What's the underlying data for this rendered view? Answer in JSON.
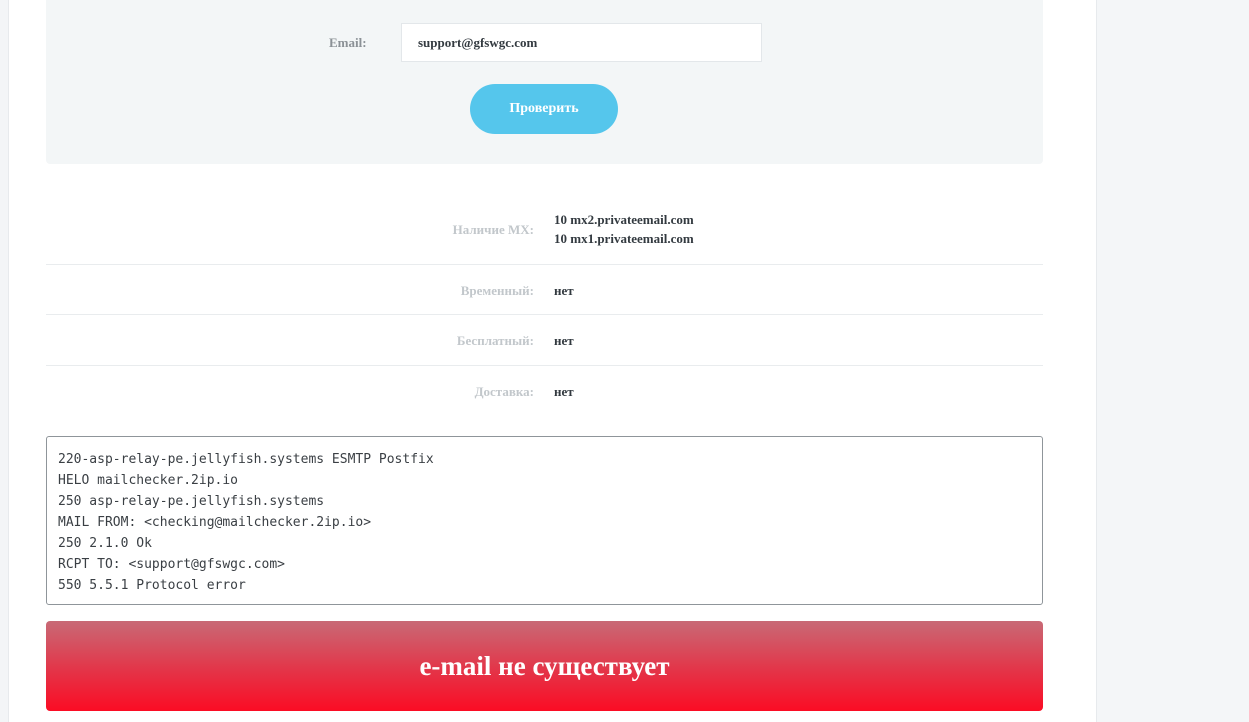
{
  "form": {
    "email_label": "Email:",
    "email_value": "support@gfswgc.com",
    "check_button": "Проверить"
  },
  "results": {
    "mx": {
      "label": "Наличие MX:",
      "values": [
        "10 mx2.privateemail.com",
        "10 mx1.privateemail.com"
      ]
    },
    "temporary": {
      "label": "Временный:",
      "value": "нет"
    },
    "free": {
      "label": "Бесплатный:",
      "value": "нет"
    },
    "delivery": {
      "label": "Доставка:",
      "value": "нет"
    }
  },
  "smtp_log": [
    "220-asp-relay-pe.jellyfish.systems ESMTP Postfix",
    "HELO mailchecker.2ip.io",
    "250 asp-relay-pe.jellyfish.systems",
    "MAIL FROM: <checking@mailchecker.2ip.io>",
    "250 2.1.0 Ok",
    "RCPT TO: <support@gfswgc.com>",
    "550 5.5.1 Protocol error"
  ],
  "verdict": "e-mail не существует"
}
